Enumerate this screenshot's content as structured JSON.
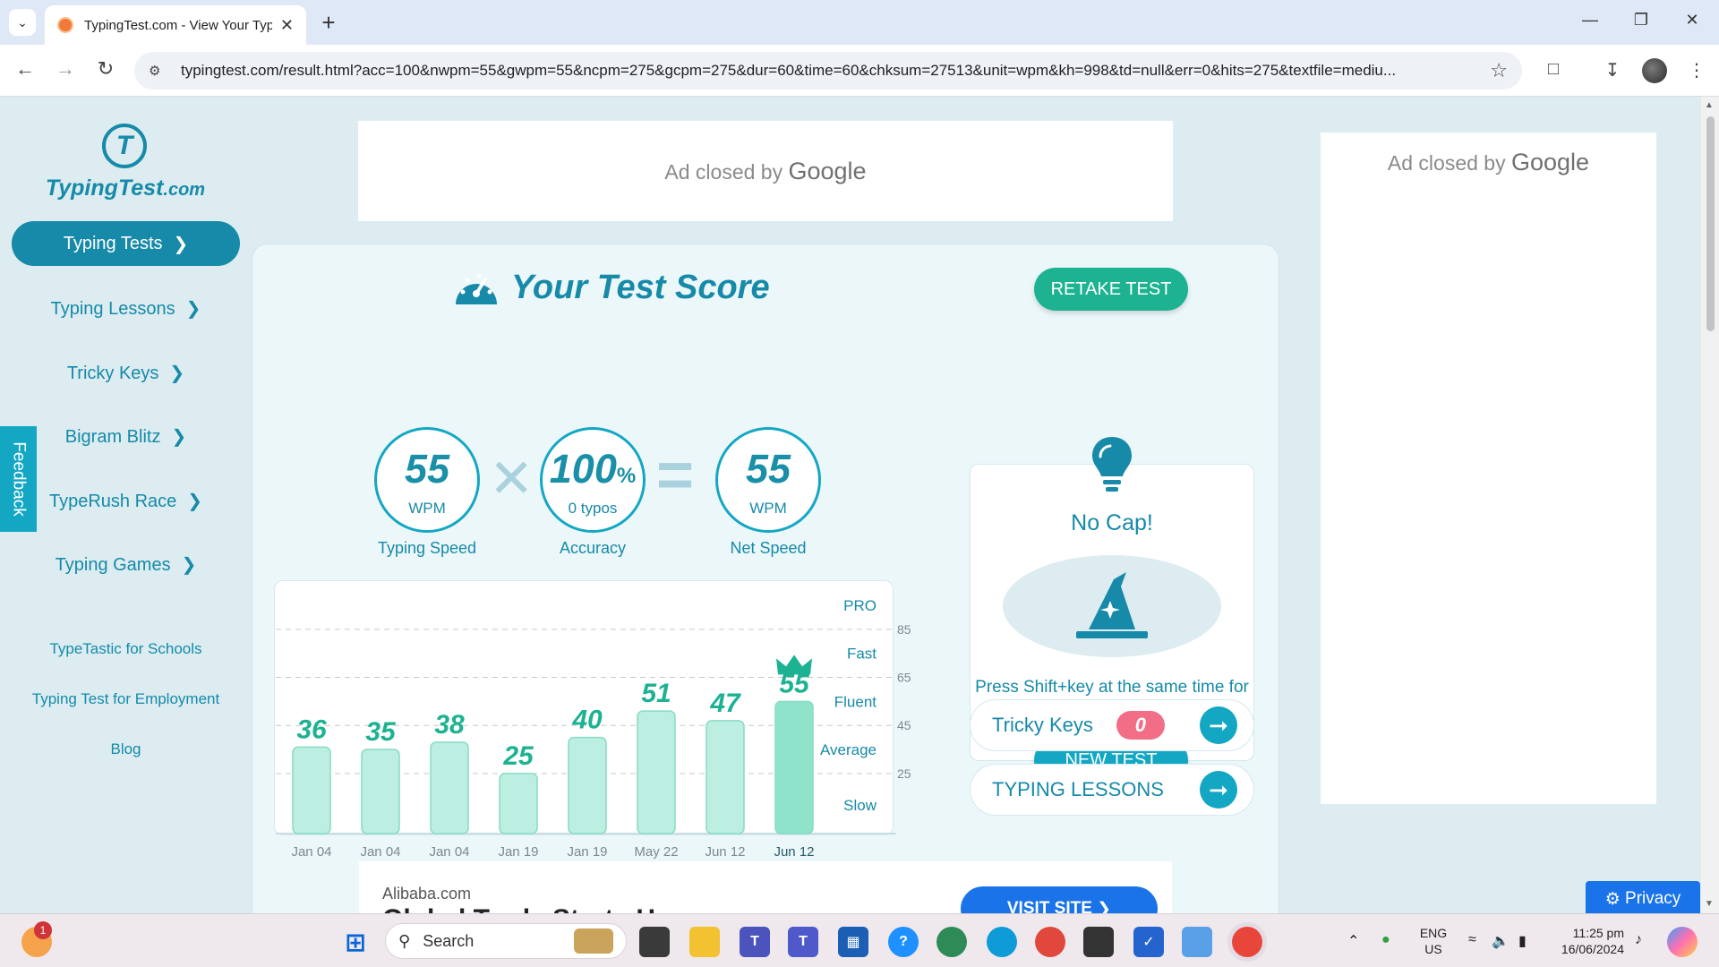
{
  "browser": {
    "tab_title": "TypingTest.com - View Your Typ",
    "url": "typingtest.com/result.html?acc=100&nwpm=55&gwpm=55&ncpm=275&gcpm=275&dur=60&time=60&chksum=27513&unit=wpm&kh=998&td=null&err=0&hits=275&textfile=mediu..."
  },
  "sidebar": {
    "logo_text": "TypingTest",
    "logo_suffix": ".com",
    "nav": [
      {
        "label": "Typing Tests",
        "active": true
      },
      {
        "label": "Typing Lessons"
      },
      {
        "label": "Tricky Keys"
      },
      {
        "label": "Bigram Blitz"
      },
      {
        "label": "TypeRush Race"
      },
      {
        "label": "Typing Games"
      }
    ],
    "links": [
      "TypeTastic for Schools",
      "Typing Test for Employment",
      "Blog"
    ],
    "feedback": "Feedback"
  },
  "ads": {
    "closed_prefix": "Ad closed by",
    "closed_brand": "Google",
    "bottom_source": "Alibaba.com",
    "bottom_headline": "Global Trade Starts Here",
    "bottom_button": "VISIT SITE",
    "privacy": "Privacy"
  },
  "result": {
    "title": "Your Test Score",
    "retake": "RETAKE TEST",
    "speed": {
      "value": "55",
      "unit": "WPM",
      "label": "Typing Speed"
    },
    "accuracy": {
      "value": "100",
      "unit": "%",
      "sub": "0 typos",
      "label": "Accuracy"
    },
    "net": {
      "value": "55",
      "unit": "WPM",
      "label": "Net Speed"
    }
  },
  "chart_data": {
    "type": "bar",
    "categories": [
      "Jan 04",
      "Jan 04",
      "Jan 04",
      "Jan 19",
      "Jan 19",
      "May 22",
      "Jun 12",
      "Jun 12"
    ],
    "values": [
      36,
      35,
      38,
      25,
      40,
      51,
      47,
      55
    ],
    "highlight_index": 7,
    "ylim": [
      0,
      95
    ],
    "gridlines": [
      25,
      45,
      65,
      85
    ],
    "levels": [
      {
        "label": "PRO",
        "y": 95
      },
      {
        "label": "Fast",
        "y": 75
      },
      {
        "label": "Fluent",
        "y": 55
      },
      {
        "label": "Average",
        "y": 35
      },
      {
        "label": "Slow",
        "y": 12
      }
    ],
    "colors": {
      "bar": "#bcefe1",
      "bar_border": "#86dcc4",
      "bar_highlight": "#8fe3cb",
      "value_label": "#1db291",
      "grid": "#c9c9c9"
    }
  },
  "tip": {
    "title": "No Cap!",
    "text": "Press Shift+key at the same time for a Capital letter!",
    "button": "NEW TEST"
  },
  "links_panel": {
    "tricky_label": "Tricky Keys",
    "tricky_count": "0",
    "lessons_label": "TYPING LESSONS"
  },
  "taskbar": {
    "search": "Search",
    "notification_count": "1",
    "lang": "ENG",
    "region": "US",
    "time": "11:25 pm",
    "date": "16/06/2024"
  }
}
